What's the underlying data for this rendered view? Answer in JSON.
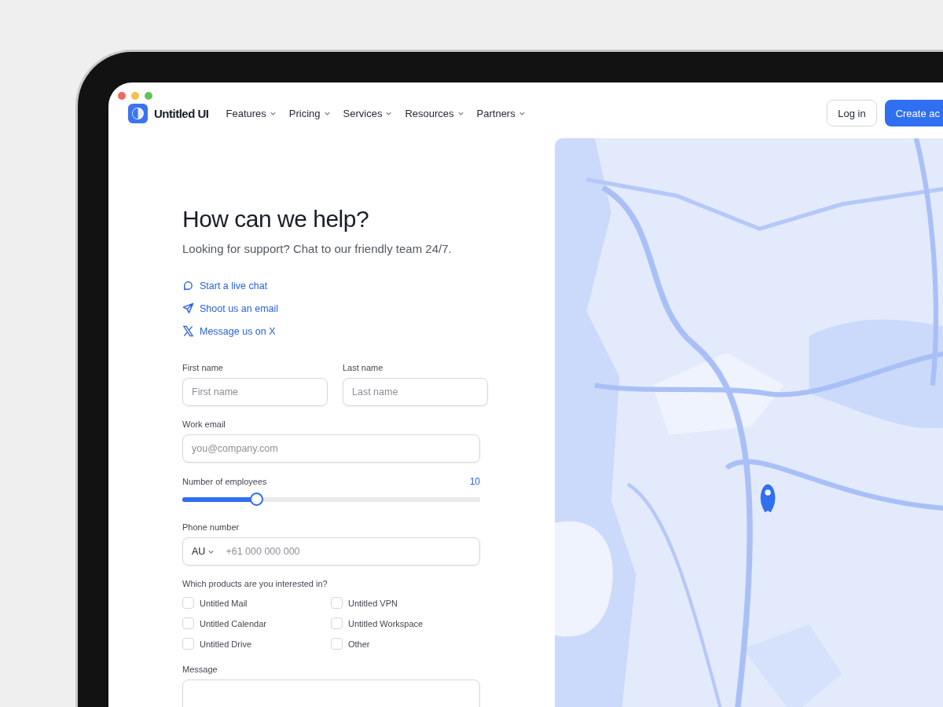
{
  "brand": {
    "name": "Untitled UI"
  },
  "nav": [
    {
      "label": "Features"
    },
    {
      "label": "Pricing"
    },
    {
      "label": "Services"
    },
    {
      "label": "Resources"
    },
    {
      "label": "Partners"
    }
  ],
  "actions": {
    "login": "Log in",
    "signup": "Create ac"
  },
  "heading": "How can we help?",
  "subtitle": "Looking for support? Chat to our friendly team 24/7.",
  "contacts": [
    {
      "kind": "chat",
      "label": "Start a live chat"
    },
    {
      "kind": "email",
      "label": "Shoot us an email"
    },
    {
      "kind": "x",
      "label": "Message us on X"
    }
  ],
  "form": {
    "first_name": {
      "label": "First name",
      "placeholder": "First name"
    },
    "last_name": {
      "label": "Last name",
      "placeholder": "Last name"
    },
    "email": {
      "label": "Work email",
      "placeholder": "you@company.com"
    },
    "employees": {
      "label": "Number of employees",
      "reading": "10",
      "level": 0.25
    },
    "phone": {
      "label": "Phone number",
      "country": "AU",
      "placeholder": "+61 000 000 000"
    },
    "products": {
      "label": "Which products are you interested in?",
      "options": [
        {
          "label": "Untitled Mail",
          "checked": false
        },
        {
          "label": "Untitled VPN",
          "checked": false
        },
        {
          "label": "Untitled Calendar",
          "checked": false
        },
        {
          "label": "Untitled Workspace",
          "checked": false
        },
        {
          "label": "Untitled Drive",
          "checked": false
        },
        {
          "label": "Other",
          "checked": false
        }
      ]
    },
    "message": {
      "label": "Message"
    }
  }
}
